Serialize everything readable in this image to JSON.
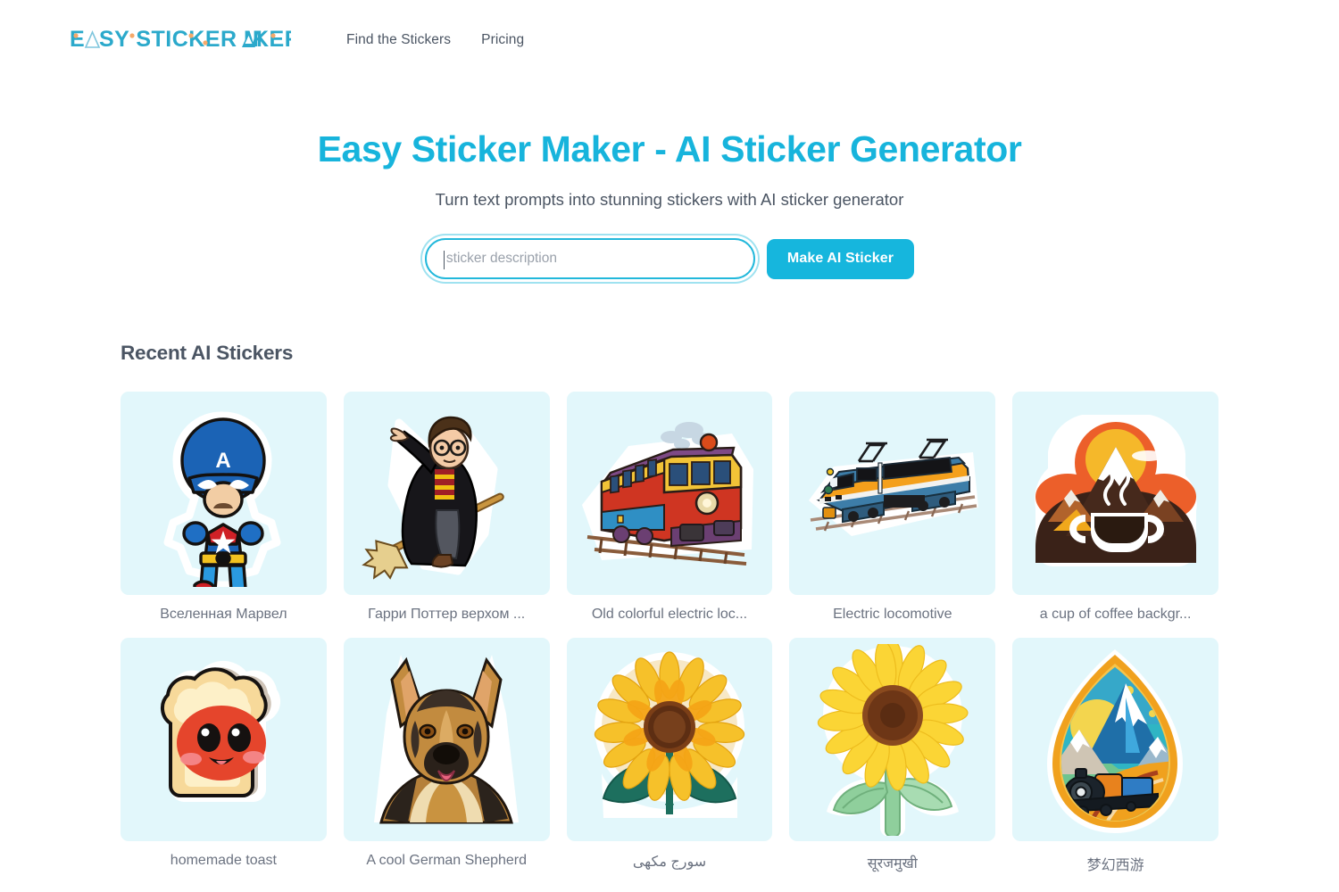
{
  "brand": {
    "logo_text_before": "E",
    "logo_text_after": "SY STICKER MAKER",
    "logo_full": "EASY STICKER MAKER",
    "color": "#29a8c9",
    "accent_dot_color": "#f5a96a"
  },
  "nav": {
    "items": [
      {
        "label": "Find the Stickers"
      },
      {
        "label": "Pricing"
      }
    ]
  },
  "hero": {
    "title": "Easy Sticker Maker - AI Sticker Generator",
    "subtitle": "Turn text prompts into stunning stickers with AI sticker generator",
    "title_color": "#17b4dc"
  },
  "search": {
    "value": "",
    "placeholder": "sticker description",
    "button_label": "Make AI Sticker",
    "button_color": "#16b6dd",
    "focused": true
  },
  "gallery": {
    "heading": "Recent AI Stickers",
    "card_background": "#e2f7fb",
    "items": [
      {
        "caption": "Вселенная Марвел",
        "icon": "captain-america-sticker"
      },
      {
        "caption": "Гарри Поттер верхом ...",
        "icon": "harry-potter-sticker"
      },
      {
        "caption": "Old colorful electric loc...",
        "icon": "old-colorful-electric-locomotive-sticker"
      },
      {
        "caption": "Electric locomotive",
        "icon": "electric-locomotive-sticker"
      },
      {
        "caption": "a cup of coffee backgr...",
        "icon": "coffee-mountain-sticker"
      },
      {
        "caption": "homemade toast",
        "icon": "toast-sticker"
      },
      {
        "caption": "A cool German Shepherd",
        "icon": "german-shepherd-sticker"
      },
      {
        "caption": "سورج مکھی",
        "icon": "sunflower-leaves-sticker"
      },
      {
        "caption": "सूरजमुखी",
        "icon": "sunflower-stem-sticker"
      },
      {
        "caption": "梦幻西游",
        "icon": "mountain-train-badge-sticker"
      }
    ]
  }
}
